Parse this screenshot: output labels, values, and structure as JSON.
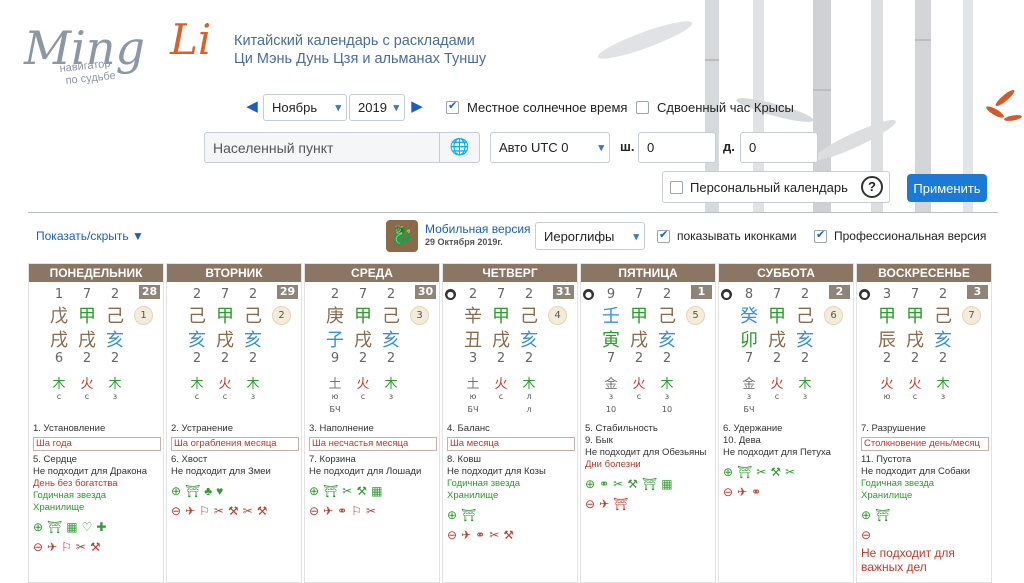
{
  "brand": {
    "name_a": "Ming",
    "name_b": "Li",
    "sub1": "навигатор",
    "sub2": "по судьбе"
  },
  "tagline": {
    "line1": "Китайский календарь с раскладами",
    "line2": "Ци Мэнь Дунь Цзя и альманах Туншу"
  },
  "controls": {
    "month": "Ноябрь",
    "year": "2019",
    "local_time_label": "Местное солнечное время",
    "local_time_checked": true,
    "rat_label": "Сдвоенный час Крысы",
    "rat_checked": false,
    "place_placeholder": "Населенный пункт",
    "utc": "Авто UTC 0",
    "lat_label": "ш.",
    "lat": "0",
    "lon_label": "д.",
    "lon": "0",
    "personal_label": "Персональный календарь",
    "help": "?",
    "apply": "Применить"
  },
  "toolbar": {
    "toggle": "Показать/скрыть",
    "mobile": "Мобильная версия",
    "mobile_date": "29 Октября 2019г.",
    "script": "Иероглифы",
    "icons_label": "показывать иконками",
    "pro_label": "Профессиональная версия"
  },
  "colors": {
    "header": "#8b7563",
    "accent": "#1a7ad6",
    "red": "#c0392b",
    "green": "#2f9a2f",
    "blue": "#3a8fd8",
    "brown": "#8a6a4a"
  },
  "days": [
    {
      "name": "ПОНЕДЕЛЬНИК",
      "num": "28",
      "moon": false,
      "top": [
        "1",
        "7",
        "2"
      ],
      "h1": [
        "戊",
        "甲",
        "己"
      ],
      "h2": [
        "戌",
        "戌",
        "亥"
      ],
      "bot": [
        "6",
        "2",
        "2"
      ],
      "star": "1",
      "el": [
        "木",
        "火",
        "木"
      ],
      "sub": [
        "с",
        "с",
        "з"
      ],
      "sub2": [
        "",
        "",
        ""
      ],
      "t1": "1. Установление",
      "box": "Ша года",
      "t2": "5. Сердце",
      "t3": "Не подходит для Дракона",
      "t4": "День без богатства",
      "t5": "Годичная звезда",
      "t6": "Хранилище",
      "ic1": [
        "⊕",
        "⛩",
        "▦",
        "♡",
        "✚"
      ],
      "ic2": [
        "⊖",
        "✈",
        "⚐",
        "✂",
        "⚒"
      ]
    },
    {
      "name": "ВТОРНИК",
      "num": "29",
      "moon": false,
      "top": [
        "2",
        "7",
        "2"
      ],
      "h1": [
        "己",
        "甲",
        "己"
      ],
      "h2": [
        "亥",
        "戌",
        "亥"
      ],
      "bot": [
        "2",
        "2",
        "2"
      ],
      "star": "2",
      "el": [
        "木",
        "火",
        "木"
      ],
      "sub": [
        "с",
        "с",
        "з"
      ],
      "sub2": [
        "",
        "",
        ""
      ],
      "t1": "2. Устранение",
      "box": "Ша ограбления месяца",
      "t2": "6. Хвост",
      "t3": "Не подходит для Змеи",
      "t4": "",
      "t5": "",
      "t6": "",
      "ic1": [
        "⊕",
        "⛩",
        "♣",
        "♥"
      ],
      "ic2": [
        "⊖",
        "✈",
        "⚐",
        "✂",
        "⚒",
        "✂",
        "⚒"
      ]
    },
    {
      "name": "СРЕДА",
      "num": "30",
      "moon": false,
      "top": [
        "2",
        "7",
        "2"
      ],
      "h1": [
        "庚",
        "甲",
        "己"
      ],
      "h2": [
        "子",
        "戌",
        "亥"
      ],
      "bot": [
        "9",
        "2",
        "2"
      ],
      "star": "3",
      "el": [
        "土",
        "火",
        "木"
      ],
      "sub": [
        "ю",
        "с",
        "з"
      ],
      "sub2": [
        "БЧ",
        "",
        ""
      ],
      "t1": "3. Наполнение",
      "box": "Ша несчастья месяца",
      "t2": "7. Корзина",
      "t3": "Не подходит для Лошади",
      "t4": "",
      "t5": "",
      "t6": "",
      "ic1": [
        "⊕",
        "⛩",
        "✂",
        "⚒",
        "▦"
      ],
      "ic2": [
        "⊖",
        "✈",
        "⚭",
        "⚐",
        "✂"
      ]
    },
    {
      "name": "ЧЕТВЕРГ",
      "num": "31",
      "moon": true,
      "top": [
        "2",
        "7",
        "2"
      ],
      "h1": [
        "辛",
        "甲",
        "己"
      ],
      "h2": [
        "丑",
        "戌",
        "亥"
      ],
      "bot": [
        "3",
        "2",
        "2"
      ],
      "star": "4",
      "el": [
        "土",
        "火",
        "木"
      ],
      "sub": [
        "ю",
        "с",
        "л"
      ],
      "sub2": [
        "БЧ",
        "",
        "л"
      ],
      "t1": "4. Баланс",
      "box": "Ша месяца",
      "t2": "8. Ковш",
      "t3": "Не подходит для Козы",
      "t4": "",
      "t5": "Годичная звезда",
      "t6": "Хранилище",
      "ic1": [
        "⊕",
        "⛩"
      ],
      "ic2": [
        "⊖",
        "✈",
        "⚭",
        "✂",
        "⚒"
      ]
    },
    {
      "name": "ПЯТНИЦА",
      "num": "1",
      "moon": true,
      "top": [
        "9",
        "7",
        "2"
      ],
      "h1": [
        "壬",
        "甲",
        "己"
      ],
      "h2": [
        "寅",
        "戌",
        "亥"
      ],
      "bot": [
        "7",
        "2",
        "2"
      ],
      "star": "5",
      "el": [
        "金",
        "火",
        "木"
      ],
      "sub": [
        "з",
        "с",
        "з"
      ],
      "sub2": [
        "10",
        "",
        "10"
      ],
      "t1": "5. Стабильность",
      "box": "",
      "t2": "9. Бык",
      "t3": "Не подходит для Обезьяны",
      "t4": "Дни болезни",
      "t5": "",
      "t6": "",
      "ic1": [
        "⊕",
        "⚭",
        "✂",
        "⚒",
        "⛩",
        "▦"
      ],
      "ic2": [
        "⊖",
        "✈",
        "⛩"
      ]
    },
    {
      "name": "СУББОТА",
      "num": "2",
      "moon": true,
      "top": [
        "8",
        "7",
        "2"
      ],
      "h1": [
        "癸",
        "甲",
        "己"
      ],
      "h2": [
        "卯",
        "戌",
        "亥"
      ],
      "bot": [
        "7",
        "2",
        "2"
      ],
      "star": "6",
      "el": [
        "金",
        "火",
        "木"
      ],
      "sub": [
        "з",
        "с",
        "з"
      ],
      "sub2": [
        "БЧ",
        "",
        ""
      ],
      "t1": "6. Удержание",
      "box": "",
      "t2": "10. Дева",
      "t3": "Не подходит для Петуха",
      "t4": "",
      "t5": "",
      "t6": "",
      "ic1": [
        "⊕",
        "⛩",
        "✂",
        "⚒",
        "✂"
      ],
      "ic2": [
        "⊖",
        "✈",
        "⚭"
      ]
    },
    {
      "name": "ВОСКРЕСЕНЬЕ",
      "num": "3",
      "moon": true,
      "top": [
        "3",
        "7",
        "2"
      ],
      "h1": [
        "甲",
        "甲",
        "己"
      ],
      "h2": [
        "辰",
        "戌",
        "亥"
      ],
      "bot": [
        "2",
        "2",
        "2"
      ],
      "star": "7",
      "el": [
        "火",
        "火",
        "木"
      ],
      "sub": [
        "ю",
        "с",
        "з"
      ],
      "sub2": [
        "",
        "",
        ""
      ],
      "t1": "7. Разрушение",
      "box": "Столкновение день/месяц",
      "t2": "11. Пустота",
      "t3": "Не подходит для Собаки",
      "t4": "",
      "t5": "Годичная звезда",
      "t6": "Хранилище",
      "ic1": [
        "⊕",
        "⛩"
      ],
      "ic2": [
        "⊖",
        "Не подходит для важных дел"
      ]
    }
  ]
}
